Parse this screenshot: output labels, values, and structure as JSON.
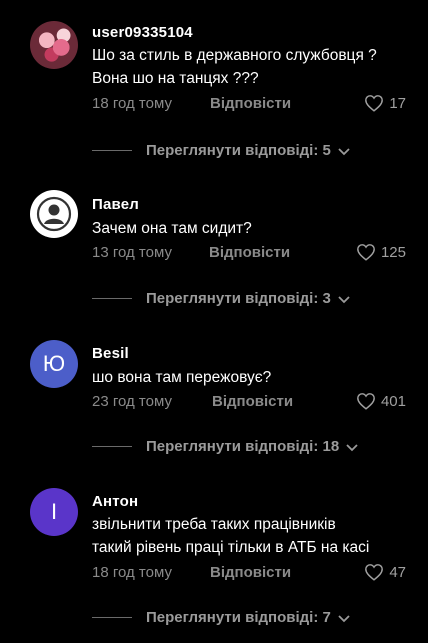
{
  "comments": [
    {
      "username": "user09335104",
      "avatar_type": "photo",
      "text_lines": [
        "Шо за стиль в державного службовця ?",
        "Вона шо на танцях ???"
      ],
      "time": "18 год тому",
      "reply_label": "Відповісти",
      "likes": "17",
      "view_replies": "Переглянути відповіді: 5"
    },
    {
      "username": "Павел",
      "avatar_type": "default-user-icon",
      "text_lines": [
        "Зачем она там сидит?"
      ],
      "time": "13 год тому",
      "reply_label": "Відповісти",
      "likes": "125",
      "view_replies": "Переглянути відповіді: 3"
    },
    {
      "username": "Besil",
      "avatar_type": "letter",
      "avatar_letter": "Ю",
      "avatar_color": "#4c5ec9",
      "text_lines": [
        "шо вона там пережовує?"
      ],
      "time": "23 год тому",
      "reply_label": "Відповісти",
      "likes": "401",
      "view_replies": "Переглянути відповіді: 18"
    },
    {
      "username": "Антон",
      "avatar_type": "letter",
      "avatar_letter": "І",
      "avatar_color": "#5a35c9",
      "text_lines": [
        "звільнити треба таких працівників",
        "такий рівень праці тільки в АТБ на касі"
      ],
      "time": "18 год тому",
      "reply_label": "Відповісти",
      "likes": "47",
      "view_replies": "Переглянути відповіді: 7"
    }
  ]
}
